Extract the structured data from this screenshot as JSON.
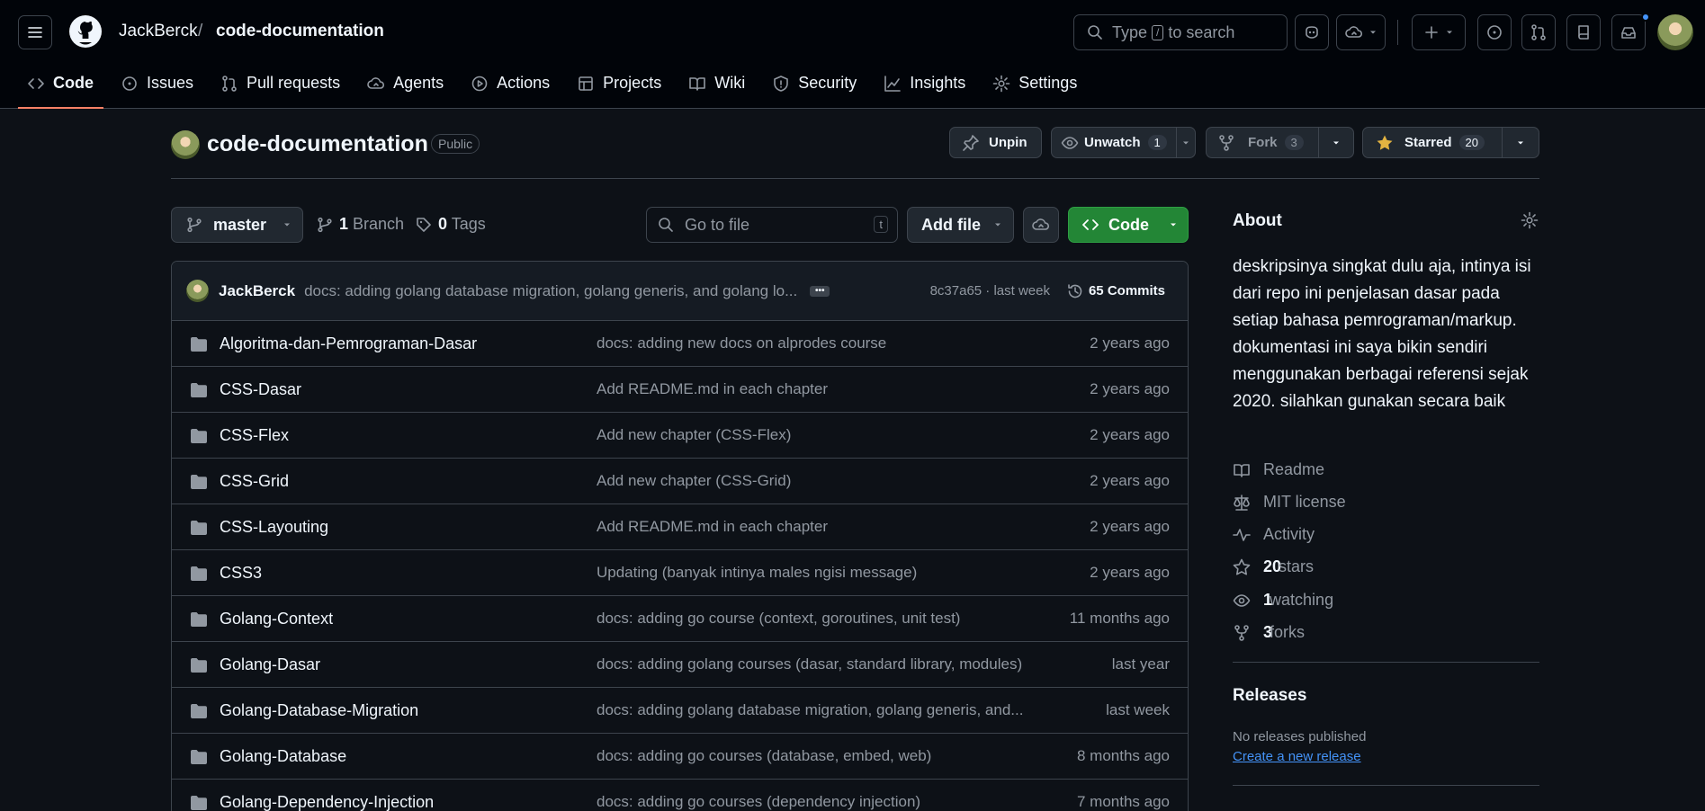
{
  "header": {
    "owner": "JackBerck",
    "separator": "/",
    "repo": "code-documentation",
    "search_prefix": "Type",
    "search_key": "/",
    "search_suffix": "to search"
  },
  "nav": {
    "items": [
      {
        "label": "Code",
        "icon": "code-icon",
        "active": true
      },
      {
        "label": "Issues",
        "icon": "issue-icon"
      },
      {
        "label": "Pull requests",
        "icon": "pull-request-icon"
      },
      {
        "label": "Agents",
        "icon": "agents-icon"
      },
      {
        "label": "Actions",
        "icon": "play-icon"
      },
      {
        "label": "Projects",
        "icon": "table-icon"
      },
      {
        "label": "Wiki",
        "icon": "book-icon"
      },
      {
        "label": "Security",
        "icon": "shield-icon"
      },
      {
        "label": "Insights",
        "icon": "graph-icon"
      },
      {
        "label": "Settings",
        "icon": "gear-icon"
      }
    ]
  },
  "repo_header": {
    "title": "code-documentation",
    "visibility": "Public",
    "unpin_label": "Unpin",
    "watch_label": "Unwatch",
    "watch_count": "1",
    "fork_label": "Fork",
    "fork_count": "3",
    "star_label": "Starred",
    "star_count": "20"
  },
  "toolbar": {
    "branch": "master",
    "branch_count": "1",
    "branch_label": "Branch",
    "tag_count": "0",
    "tag_label": "Tags",
    "goto_placeholder": "Go to file",
    "goto_key": "t",
    "add_file_label": "Add file",
    "code_label": "Code"
  },
  "latest_commit": {
    "author": "JackBerck",
    "message": "docs: adding golang database migration, golang generis, and golang lo...",
    "meta": "8c37a65 · last week",
    "count_label": "65 Commits"
  },
  "files": [
    {
      "name": "Algoritma-dan-Pemrograman-Dasar",
      "message": "docs: adding new docs on alprodes course",
      "time": "2 years ago"
    },
    {
      "name": "CSS-Dasar",
      "message": "Add README.md in each chapter",
      "time": "2 years ago"
    },
    {
      "name": "CSS-Flex",
      "message": "Add new chapter (CSS-Flex)",
      "time": "2 years ago"
    },
    {
      "name": "CSS-Grid",
      "message": "Add new chapter (CSS-Grid)",
      "time": "2 years ago"
    },
    {
      "name": "CSS-Layouting",
      "message": "Add README.md in each chapter",
      "time": "2 years ago"
    },
    {
      "name": "CSS3",
      "message": "Updating (banyak intinya males ngisi message)",
      "time": "2 years ago"
    },
    {
      "name": "Golang-Context",
      "message": "docs: adding go course (context, goroutines, unit test)",
      "time": "11 months ago"
    },
    {
      "name": "Golang-Dasar",
      "message": "docs: adding golang courses (dasar, standard library, modules)",
      "time": "last year"
    },
    {
      "name": "Golang-Database-Migration",
      "message": "docs: adding golang database migration, golang generis, and...",
      "time": "last week"
    },
    {
      "name": "Golang-Database",
      "message": "docs: adding go courses (database, embed, web)",
      "time": "8 months ago"
    },
    {
      "name": "Golang-Dependency-Injection",
      "message": "docs: adding go courses (dependency injection)",
      "time": "7 months ago"
    }
  ],
  "about": {
    "title": "About",
    "description": "deskripsinya singkat dulu aja, intinya isi dari repo ini penjelasan dasar pada setiap bahasa pemrograman/markup. dokumentasi ini saya bikin sendiri menggunakan berbagai referensi sejak 2020. silahkan gunakan secara baik",
    "readme": "Readme",
    "license": "MIT license",
    "activity": "Activity",
    "stars_count": "20",
    "stars_label": "stars",
    "watching_count": "1",
    "watching_label": "watching",
    "forks_count": "3",
    "forks_label": "forks"
  },
  "releases": {
    "title": "Releases",
    "empty": "No releases published",
    "create_link": "Create a new release"
  }
}
